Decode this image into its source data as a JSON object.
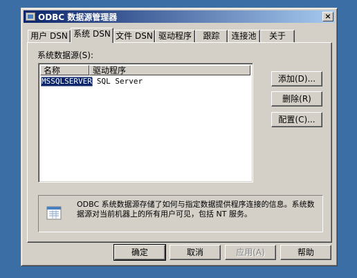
{
  "window": {
    "title": "ODBC 数据源管理器",
    "close_label": "×"
  },
  "tabs": [
    {
      "label": "用户 DSN"
    },
    {
      "label": "系统 DSN"
    },
    {
      "label": "文件 DSN"
    },
    {
      "label": "驱动程序"
    },
    {
      "label": "跟踪"
    },
    {
      "label": "连接池"
    },
    {
      "label": "关于"
    }
  ],
  "active_tab": "系统 DSN",
  "system_dsn": {
    "section_label": "系统数据源(S):",
    "columns": [
      "名称",
      "驱动程序"
    ],
    "rows": [
      {
        "name": "MSSQLSERVER",
        "driver": "SQL Server",
        "selected": true
      }
    ],
    "buttons": {
      "add": "添加(D)...",
      "remove": "删除(R)",
      "configure": "配置(C)..."
    },
    "info_text": "ODBC 系统数据源存储了如何与指定数据提供程序连接的信息。系统数据源对当前机器上的所有用户可见，包括 NT 服务。",
    "info_icon": "odbc-datasource-icon"
  },
  "footer": {
    "ok": "确定",
    "cancel": "取消",
    "apply": "应用(A)",
    "help": "帮助"
  },
  "colors": {
    "desktop": "#3a6ea5",
    "titlebar_start": "#0a246a",
    "titlebar_end": "#a6caf0",
    "selection": "#0a246a",
    "face": "#d4d0c8"
  }
}
